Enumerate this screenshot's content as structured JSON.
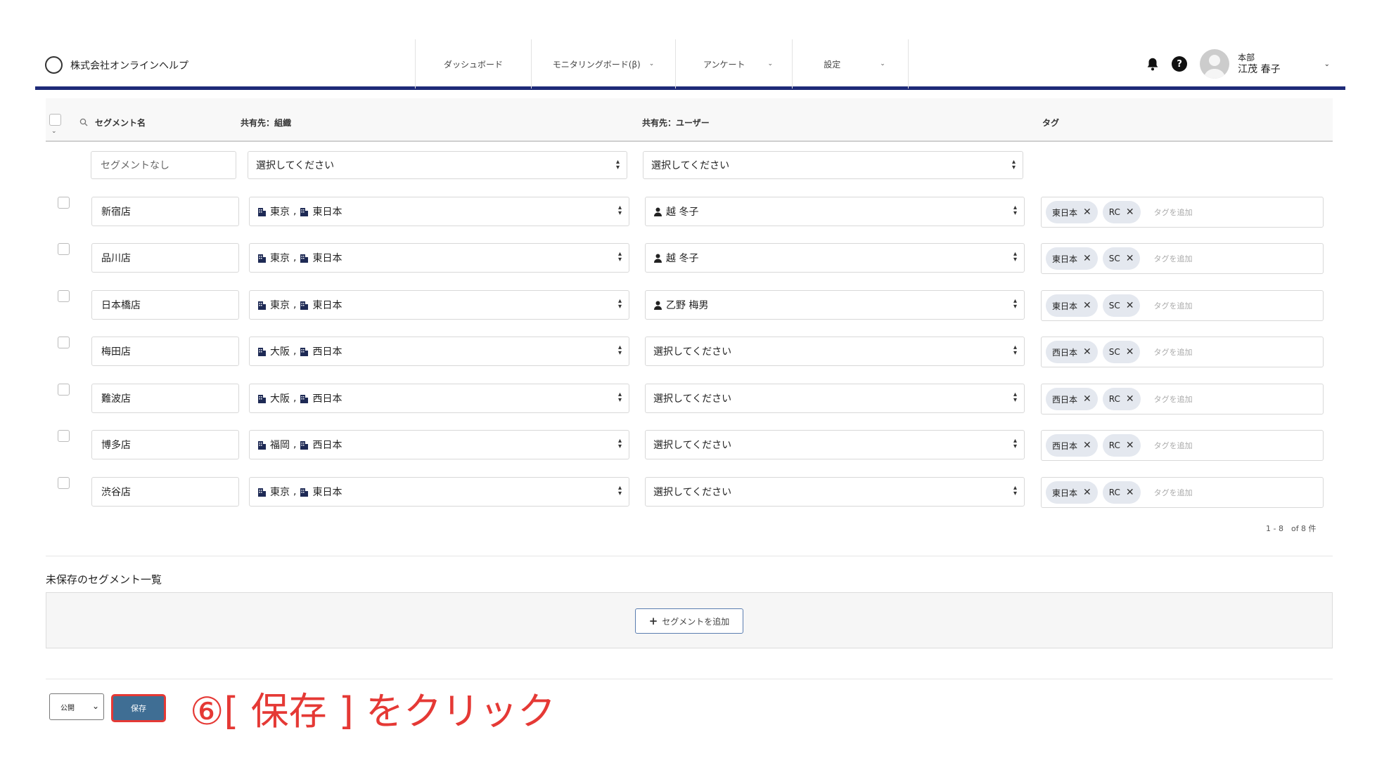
{
  "header": {
    "company": "株式会社オンラインヘルプ",
    "nav": [
      {
        "label": "ダッシュボード",
        "chevron": false
      },
      {
        "label": "モニタリングボード(β)",
        "chevron": true
      },
      {
        "label": "アンケート",
        "chevron": true
      },
      {
        "label": "設定",
        "chevron": true
      }
    ],
    "help_glyph": "?",
    "user_dept": "本部",
    "user_name": "江茂 春子"
  },
  "table": {
    "col_segment": "セグメント名",
    "col_org": "共有先：組織",
    "col_user": "共有先：ユーザー",
    "col_tag": "タグ",
    "filter_row": {
      "segment_placeholder": "セグメントなし",
      "org": "選択してください",
      "user": "選択してください"
    },
    "tag_placeholder": "タグを追加",
    "rows": [
      {
        "name": "新宿店",
        "org1": "東京",
        "org2": "東日本",
        "user": "越 冬子",
        "tags": [
          "東日本",
          "RC"
        ]
      },
      {
        "name": "品川店",
        "org1": "東京",
        "org2": "東日本",
        "user": "越 冬子",
        "tags": [
          "東日本",
          "SC"
        ]
      },
      {
        "name": "日本橋店",
        "org1": "東京",
        "org2": "東日本",
        "user": "乙野 梅男",
        "tags": [
          "東日本",
          "SC"
        ]
      },
      {
        "name": "梅田店",
        "org1": "大阪",
        "org2": "西日本",
        "user": "選択してください",
        "tags": [
          "西日本",
          "SC"
        ]
      },
      {
        "name": "難波店",
        "org1": "大阪",
        "org2": "西日本",
        "user": "選択してください",
        "tags": [
          "西日本",
          "RC"
        ]
      },
      {
        "name": "博多店",
        "org1": "福岡",
        "org2": "西日本",
        "user": "選択してください",
        "tags": [
          "西日本",
          "RC"
        ]
      },
      {
        "name": "渋谷店",
        "org1": "東京",
        "org2": "東日本",
        "user": "選択してください",
        "tags": [
          "東日本",
          "RC"
        ]
      }
    ],
    "pager": "1 - 8　of 8 件"
  },
  "unsaved": {
    "title": "未保存のセグメント一覧",
    "add_label": "セグメントを追加"
  },
  "footer": {
    "publish_value": "公開",
    "save_label": "保存"
  },
  "annotation": "⑥[ 保存 ] をクリック",
  "colors": {
    "header_border": "#1e2a78",
    "save_button": "#3f6e94",
    "annotation": "#e53935"
  }
}
